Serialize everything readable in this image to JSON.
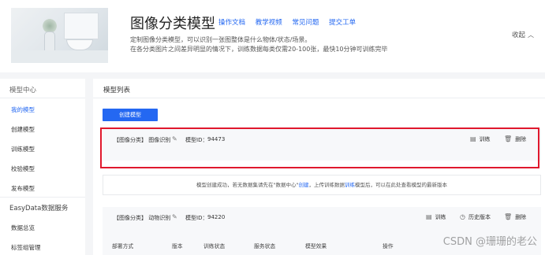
{
  "header": {
    "title": "图像分类模型",
    "links": [
      "操作文档",
      "教学视频",
      "常见问题",
      "提交工单"
    ],
    "description_line1": "定制图像分类模型，可以识别一张图整体是什么物体/状态/场景。",
    "description_line2": "在各分类图片之间差异明显的情况下，训练数据每类仅需20-100张，最快10分钟可训练完毕",
    "collapse_label": "收起",
    "collapse_icon": "chevron-up-icon"
  },
  "sidebar": {
    "heading": "模型中心",
    "items": [
      "我的模型",
      "创建模型",
      "训练模型",
      "校验模型",
      "发布模型"
    ],
    "section2_heading": "EasyData数据服务",
    "section2_items": [
      "数据总览",
      "标签组管理"
    ]
  },
  "main": {
    "title": "模型列表",
    "create_button": "创建模型",
    "cards": [
      {
        "tag": "【图像分类】 图像识别",
        "model_id_label": "模型ID：",
        "model_id": "94473",
        "actions": [
          "训练",
          "删除"
        ]
      },
      {
        "tag": "【图像分类】 动物识别",
        "model_id_label": "模型ID：",
        "model_id": "94220",
        "actions": [
          "训练",
          "历史版本",
          "删除"
        ],
        "table_headers": [
          "部署方式",
          "版本",
          "训练状态",
          "服务状态",
          "模型效果",
          "操作"
        ]
      }
    ],
    "notice": {
      "before": "模型创建成功，若无数据集请先在\"数据中心\"",
      "link1": "创建",
      "middle": "，上传训练数据",
      "link2": "训练",
      "after": "模型后，可以在此处查看模型的最新版本"
    }
  },
  "watermark": "CSDN @珊珊的老公",
  "colors": {
    "accent": "#2468f2",
    "highlight_border": "#e0182d",
    "background": "#f4f5f7"
  }
}
